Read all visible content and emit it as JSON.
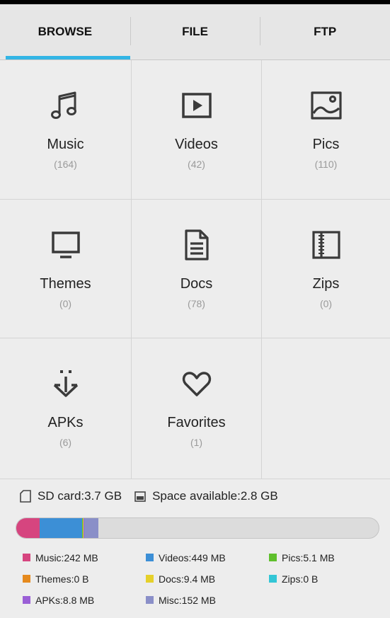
{
  "tabs": [
    {
      "label": "BROWSE",
      "active": true
    },
    {
      "label": "FILE",
      "active": false
    },
    {
      "label": "FTP",
      "active": false
    }
  ],
  "categories": [
    {
      "label": "Music",
      "count": "(164)",
      "icon": "music-note-icon"
    },
    {
      "label": "Videos",
      "count": "(42)",
      "icon": "play-icon"
    },
    {
      "label": "Pics",
      "count": "(110)",
      "icon": "picture-icon"
    },
    {
      "label": "Themes",
      "count": "(0)",
      "icon": "monitor-icon"
    },
    {
      "label": "Docs",
      "count": "(78)",
      "icon": "document-icon"
    },
    {
      "label": "Zips",
      "count": "(0)",
      "icon": "zip-archive-icon"
    },
    {
      "label": "APKs",
      "count": "(6)",
      "icon": "android-apk-icon"
    },
    {
      "label": "Favorites",
      "count": "(1)",
      "icon": "heart-icon"
    }
  ],
  "storage": {
    "sd_card": "SD card:3.7 GB",
    "space_available": "Space available:2.8 GB",
    "usage_fractions": {
      "music": 0.064,
      "videos": 0.118,
      "pics": 0.001,
      "docs": 0.002,
      "apks": 0.002,
      "misc": 0.04
    },
    "legend": [
      {
        "text": "Music:242 MB",
        "color": "#d6457f"
      },
      {
        "text": "Videos:449 MB",
        "color": "#3c8fd6"
      },
      {
        "text": "Pics:5.1 MB",
        "color": "#5fbf2c"
      },
      {
        "text": "Themes:0 B",
        "color": "#e58a1e"
      },
      {
        "text": "Docs:9.4 MB",
        "color": "#e5d02a"
      },
      {
        "text": "Zips:0 B",
        "color": "#33c6d6"
      },
      {
        "text": "APKs:8.8 MB",
        "color": "#9a5fd6"
      },
      {
        "text": "Misc:152 MB",
        "color": "#8a8fc8"
      }
    ]
  },
  "colors": {
    "tab_indicator": "#33b5e5",
    "bar_track": "#dcdcdc"
  }
}
